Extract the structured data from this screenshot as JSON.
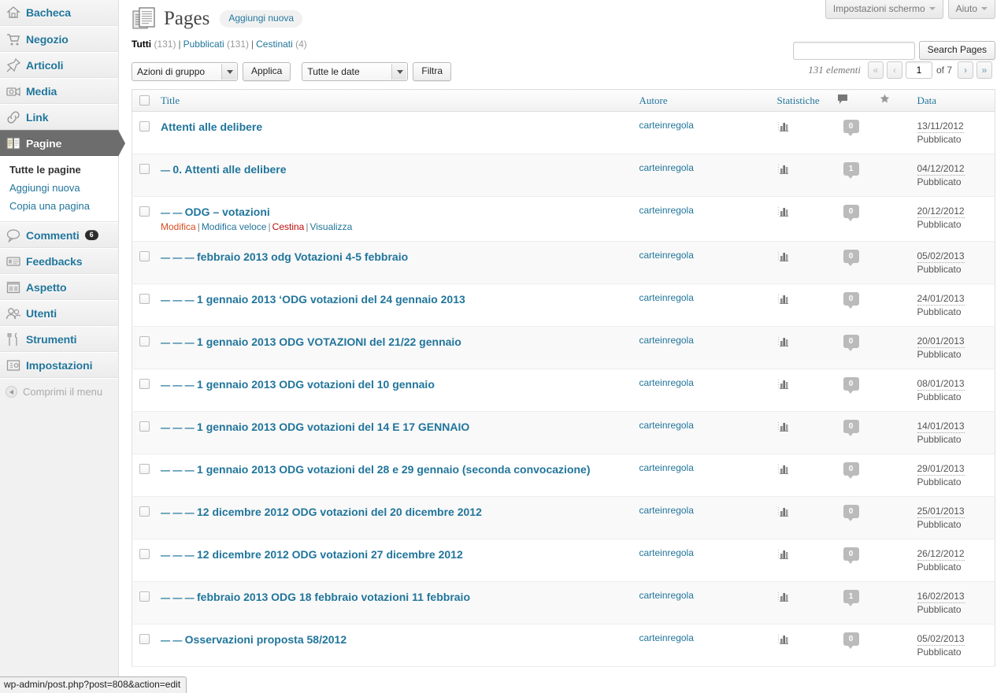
{
  "sidebar": {
    "items": [
      {
        "label": "Bacheca",
        "icon": "dashboard-icon"
      },
      {
        "label": "Negozio",
        "icon": "cart-icon"
      },
      {
        "label": "Articoli",
        "icon": "pin-icon"
      },
      {
        "label": "Media",
        "icon": "camera-icon"
      },
      {
        "label": "Link",
        "icon": "link-icon"
      },
      {
        "label": "Pagine",
        "icon": "pages-icon",
        "current": true
      },
      {
        "label": "Commenti",
        "icon": "comment-icon",
        "badge": "6"
      },
      {
        "label": "Feedbacks",
        "icon": "feedback-icon"
      },
      {
        "label": "Aspetto",
        "icon": "appearance-icon"
      },
      {
        "label": "Utenti",
        "icon": "users-icon"
      },
      {
        "label": "Strumenti",
        "icon": "tools-icon"
      },
      {
        "label": "Impostazioni",
        "icon": "settings-icon"
      }
    ],
    "submenu": [
      {
        "label": "Tutte le pagine",
        "active": true
      },
      {
        "label": "Aggiungi nuova",
        "active": false
      },
      {
        "label": "Copia una pagina",
        "active": false
      }
    ],
    "collapse_label": "Comprimi il menu"
  },
  "screen_meta": {
    "screen_options": "Impostazioni schermo",
    "help": "Aiuto"
  },
  "header": {
    "title": "Pages",
    "add_new": "Aggiungi nuova",
    "icon": "pages-page-icon"
  },
  "status_filters": [
    {
      "label": "Tutti",
      "count": "(131)",
      "current": true
    },
    {
      "label": "Pubblicati",
      "count": "(131)",
      "current": false
    },
    {
      "label": "Cestinati",
      "count": "(4)",
      "current": false
    }
  ],
  "search": {
    "value": "",
    "placeholder": "",
    "button_label": "Search Pages"
  },
  "tablenav": {
    "bulk_actions": "Azioni di gruppo",
    "apply_label": "Applica",
    "date_filter": "Tutte le date",
    "filter_label": "Filtra",
    "displaying_num": "131 elementi",
    "first_label": "«",
    "prev_label": "‹",
    "current_page": "1",
    "total_pages": "of 7",
    "next_label": "›",
    "last_label": "»"
  },
  "table": {
    "columns": [
      {
        "key": "cb",
        "label": ""
      },
      {
        "key": "title",
        "label": "Title"
      },
      {
        "key": "author",
        "label": "Autore"
      },
      {
        "key": "stats",
        "label": "Statistiche"
      },
      {
        "key": "comments",
        "label": "",
        "icon": "comment-bubble-icon"
      },
      {
        "key": "star",
        "label": "",
        "icon": "star-icon"
      },
      {
        "key": "date",
        "label": "Data"
      }
    ],
    "row_actions": {
      "edit": "Modifica",
      "quick_edit": "Modifica veloce",
      "trash": "Cestina",
      "view": "Visualizza"
    },
    "rows": [
      {
        "prefix": "",
        "title": "Attenti alle delibere",
        "author": "carteinregola",
        "comments": "0",
        "date": "13/11/2012",
        "status": "Pubblicato",
        "hover": false
      },
      {
        "prefix": "—",
        "title": "0. Attenti alle delibere",
        "author": "carteinregola",
        "comments": "1",
        "date": "04/12/2012",
        "status": "Pubblicato",
        "hover": false
      },
      {
        "prefix": "— —",
        "title": "ODG – votazioni",
        "author": "carteinregola",
        "comments": "0",
        "date": "20/12/2012",
        "status": "Pubblicato",
        "hover": true
      },
      {
        "prefix": "— — —",
        "title": "febbraio 2013 odg Votazioni 4-5 febbraio",
        "author": "carteinregola",
        "comments": "0",
        "date": "05/02/2013",
        "status": "Pubblicato",
        "hover": false
      },
      {
        "prefix": "— — —",
        "title": "1 gennaio 2013 ‘ODG votazioni del 24 gennaio 2013",
        "author": "carteinregola",
        "comments": "0",
        "date": "24/01/2013",
        "status": "Pubblicato",
        "hover": false
      },
      {
        "prefix": "— — —",
        "title": "1 gennaio 2013 ODG VOTAZIONI del 21/22 gennaio",
        "author": "carteinregola",
        "comments": "0",
        "date": "20/01/2013",
        "status": "Pubblicato",
        "hover": false
      },
      {
        "prefix": "— — —",
        "title": "1 gennaio 2013 ODG votazioni del 10 gennaio",
        "author": "carteinregola",
        "comments": "0",
        "date": "08/01/2013",
        "status": "Pubblicato",
        "hover": false
      },
      {
        "prefix": "— — —",
        "title": "1 gennaio 2013 ODG votazioni del 14 E 17 GENNAIO",
        "author": "carteinregola",
        "comments": "0",
        "date": "14/01/2013",
        "status": "Pubblicato",
        "hover": false
      },
      {
        "prefix": "— — —",
        "title": "1 gennaio 2013 ODG votazioni del 28 e 29 gennaio (seconda convocazione)",
        "author": "carteinregola",
        "comments": "0",
        "date": "29/01/2013",
        "status": "Pubblicato",
        "hover": false
      },
      {
        "prefix": "— — —",
        "title": "12 dicembre 2012 ODG votazioni del 20 dicembre 2012",
        "author": "carteinregola",
        "comments": "0",
        "date": "25/01/2013",
        "status": "Pubblicato",
        "hover": false
      },
      {
        "prefix": "— — —",
        "title": "12 dicembre 2012 ODG votazioni 27 dicembre 2012",
        "author": "carteinregola",
        "comments": "0",
        "date": "26/12/2012",
        "status": "Pubblicato",
        "hover": false
      },
      {
        "prefix": "— — —",
        "title": "febbraio 2013 ODG 18 febbraio votazioni 11 febbraio",
        "author": "carteinregola",
        "comments": "1",
        "date": "16/02/2013",
        "status": "Pubblicato",
        "hover": false
      },
      {
        "prefix": "— —",
        "title": "Osservazioni proposta 58/2012",
        "author": "carteinregola",
        "comments": "0",
        "date": "05/02/2013",
        "status": "Pubblicato",
        "hover": false
      }
    ]
  },
  "statusbar": {
    "url": "wp-admin/post.php?post=808&action=edit"
  },
  "colors": {
    "link": "#21759b",
    "current_menu_bg": "#6d6d6d",
    "row_alt": "#f9f9f9",
    "edit_hover": "#d54e21",
    "trash": "#bc0b0b"
  }
}
